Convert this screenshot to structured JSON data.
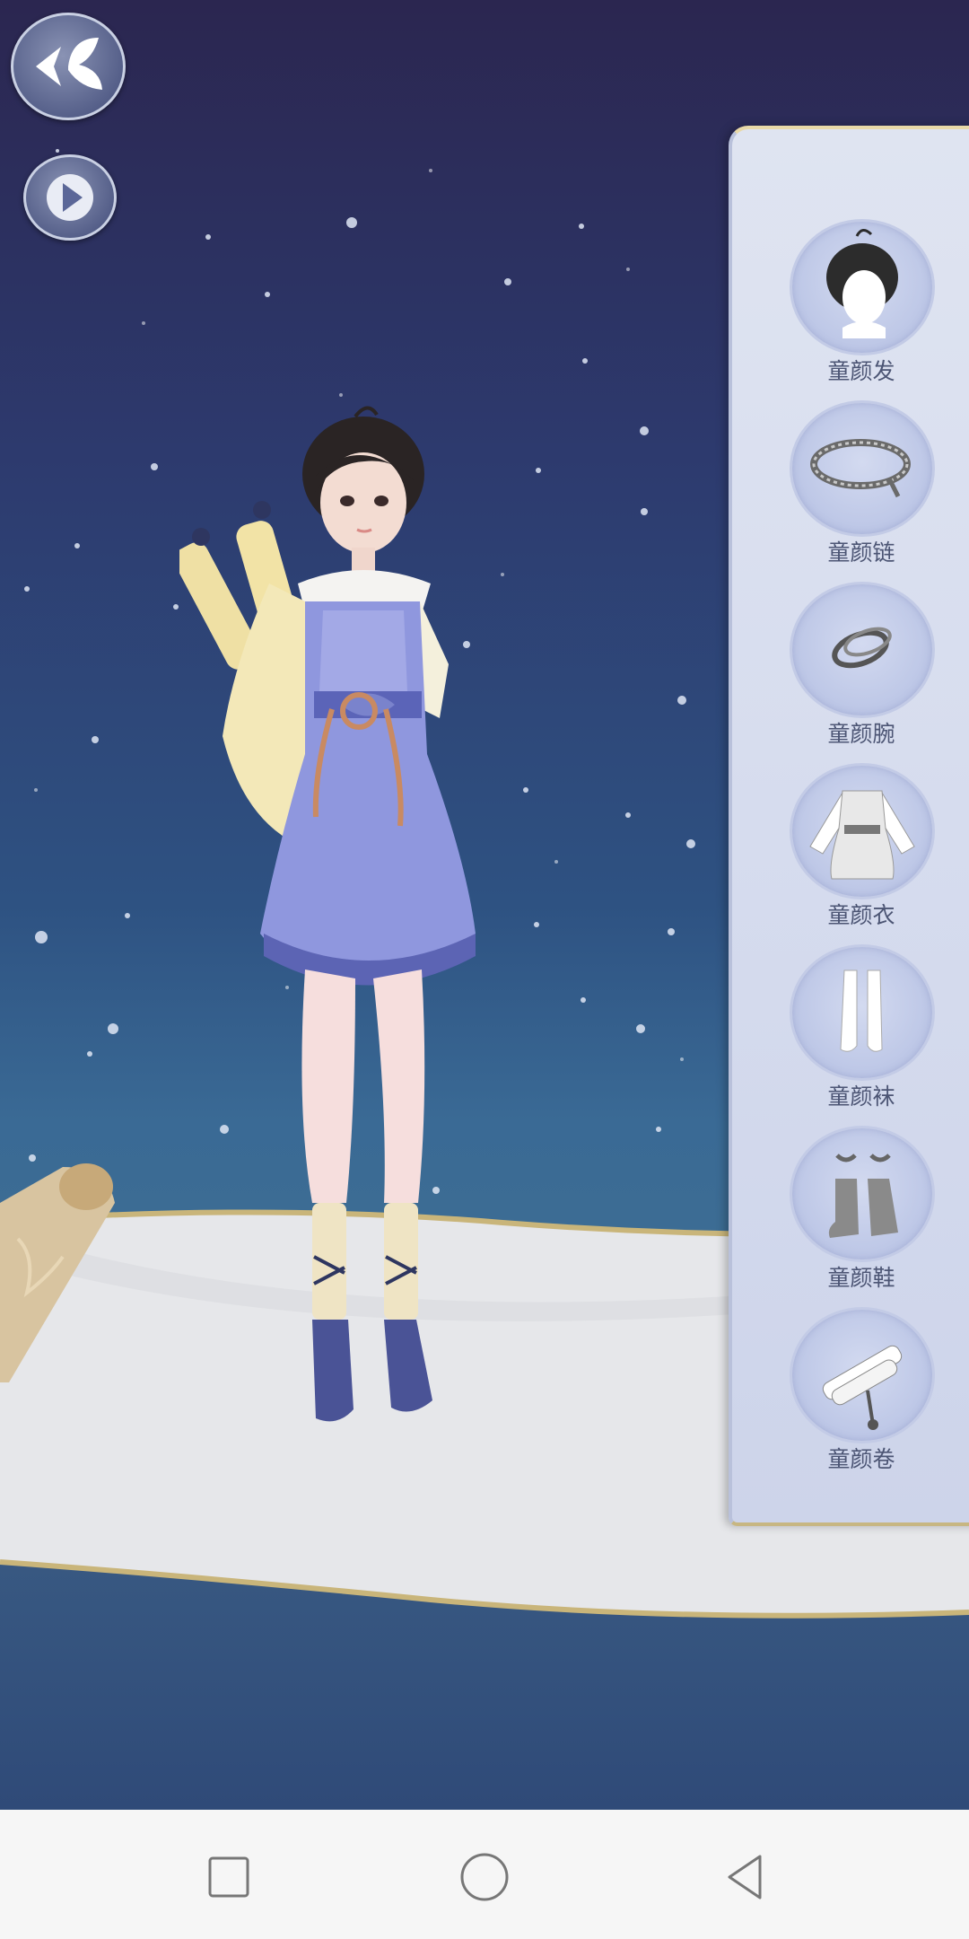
{
  "screen": {
    "background_top": "#2b2650",
    "background_bottom": "#3d6d93",
    "panel_color": "#dfe4f1",
    "label_color": "#4c5574"
  },
  "top_controls": {
    "back_icon": "butterfly-back-icon",
    "play_icon": "play-triangle-icon"
  },
  "outfit_panel": {
    "items": [
      {
        "label": "童颜发",
        "icon": "hair-icon"
      },
      {
        "label": "童颜链",
        "icon": "necklace-icon"
      },
      {
        "label": "童颜腕",
        "icon": "bracelet-icon"
      },
      {
        "label": "童颜衣",
        "icon": "dress-icon"
      },
      {
        "label": "童颜袜",
        "icon": "socks-icon"
      },
      {
        "label": "童颜鞋",
        "icon": "boots-icon"
      },
      {
        "label": "童颜卷",
        "icon": "scroll-icon"
      }
    ]
  },
  "system_nav": {
    "recent_icon": "square-icon",
    "home_icon": "circle-icon",
    "back_icon": "triangle-back-icon"
  }
}
